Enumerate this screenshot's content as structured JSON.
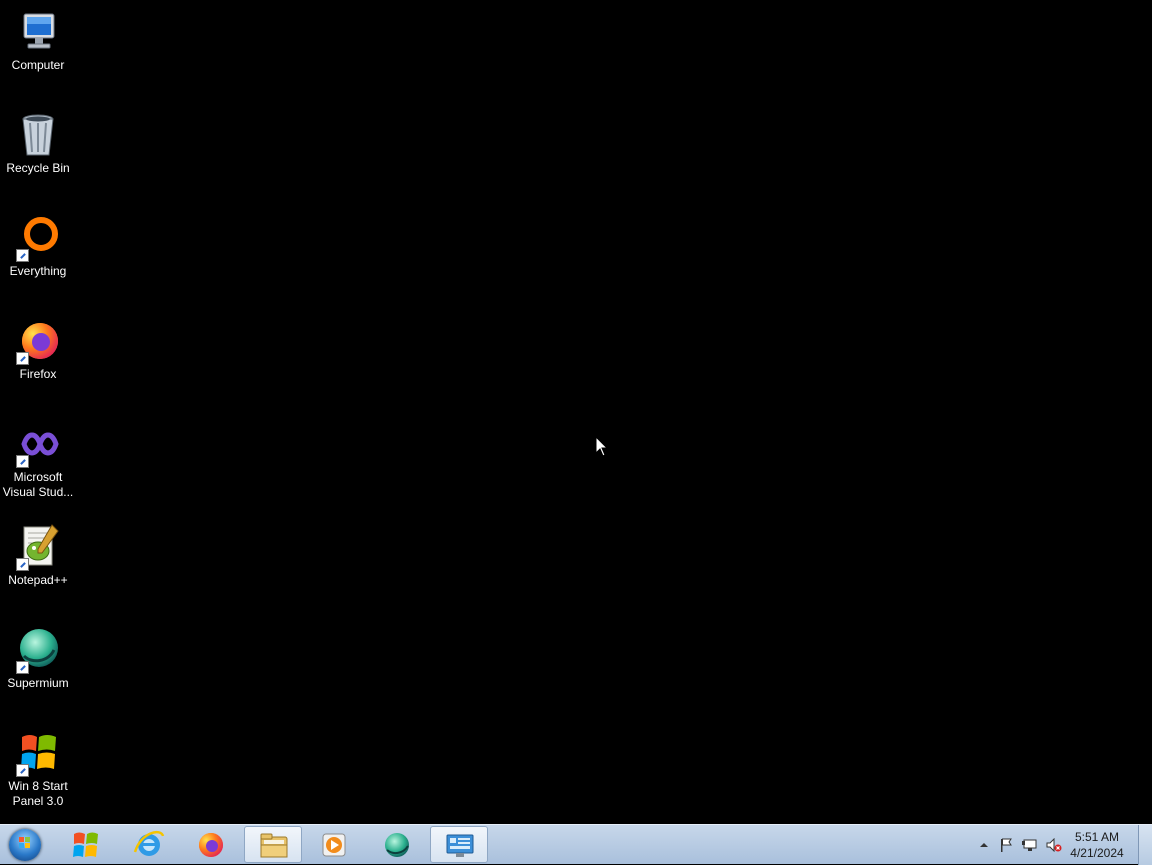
{
  "desktop": {
    "icons": [
      {
        "label": "Computer",
        "icon": "computer-icon"
      },
      {
        "label": "Recycle Bin",
        "icon": "recycle-bin-icon"
      },
      {
        "label": "Everything",
        "icon": "everything-icon"
      },
      {
        "label": "Firefox",
        "icon": "firefox-icon"
      },
      {
        "label": "Microsoft Visual Stud...",
        "icon": "visual-studio-icon"
      },
      {
        "label": "Notepad++",
        "icon": "notepadpp-icon"
      },
      {
        "label": "Supermium",
        "icon": "supermium-icon"
      },
      {
        "label": "Win 8 Start Panel 3.0",
        "icon": "win8-start-panel-icon"
      }
    ]
  },
  "taskbar": {
    "start_icon": "windows-start-orb-icon",
    "pinned": [
      {
        "icon": "win8-start-panel-icon"
      },
      {
        "icon": "internet-explorer-icon"
      },
      {
        "icon": "firefox-icon"
      },
      {
        "icon": "file-explorer-icon"
      },
      {
        "icon": "media-player-icon"
      },
      {
        "icon": "supermium-icon"
      },
      {
        "icon": "control-panel-icon"
      }
    ],
    "tray": {
      "icons": [
        "show-hidden-icons-arrow",
        "action-center-flag-icon",
        "network-icon",
        "volume-muted-icon"
      ]
    },
    "clock": {
      "time": "5:51 AM",
      "date": "4/21/2024"
    }
  },
  "colors": {
    "desktop_background": "#000000",
    "taskbar_top": "#c7d7ea",
    "taskbar_bottom": "#a9c0dc"
  }
}
